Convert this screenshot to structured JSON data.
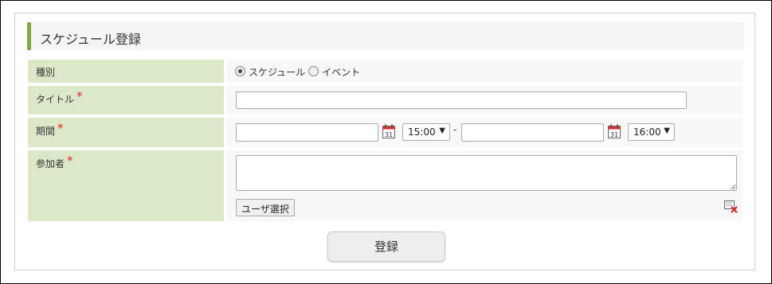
{
  "header": {
    "title": "スケジュール登録"
  },
  "form": {
    "type_label": "種別",
    "type_options": [
      "スケジュール",
      "イベント"
    ],
    "title_label": "タイトル",
    "title_value": "",
    "period_label": "期間",
    "period_start_date": "",
    "period_start_time": "15:00",
    "period_separator": "-",
    "period_end_date": "",
    "period_end_time": "16:00",
    "participants_label": "参加者",
    "participants_value": "",
    "user_select_label": "ユーザ選択",
    "required_mark": "*",
    "calendar_day": "31"
  },
  "actions": {
    "submit_label": "登録"
  },
  "colors": {
    "label_bg": "#dce9c9",
    "accent": "#7fa84a",
    "required": "#e22"
  }
}
